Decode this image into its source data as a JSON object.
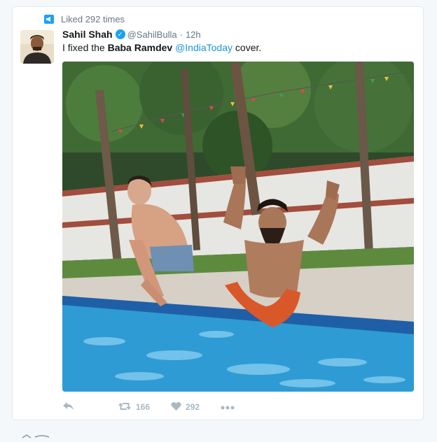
{
  "context": {
    "icon": "megaphone-icon",
    "label": "Liked 292 times"
  },
  "tweet": {
    "avatar": "avatar",
    "name": "Sahil Shah",
    "verified_icon": "verified-badge-icon",
    "handle": "@SahilBulla",
    "separator": "·",
    "time": "12h",
    "text_prefix": "I fixed the ",
    "text_bold": "Baba Ramdev",
    "text_space": " ",
    "text_mention": "@IndiaToday",
    "text_suffix": " cover.",
    "media_icon": "pool-photo"
  },
  "actions": {
    "reply_icon": "reply-icon",
    "retweet_icon": "retweet-icon",
    "retweet_count": "166",
    "like_icon": "heart-icon",
    "like_count": "292",
    "more_icon": "more-icon"
  },
  "colors": {
    "accent": "#1da1f2",
    "mention": "#1b95e0",
    "muted": "#657786",
    "action": "#aab8c2"
  }
}
